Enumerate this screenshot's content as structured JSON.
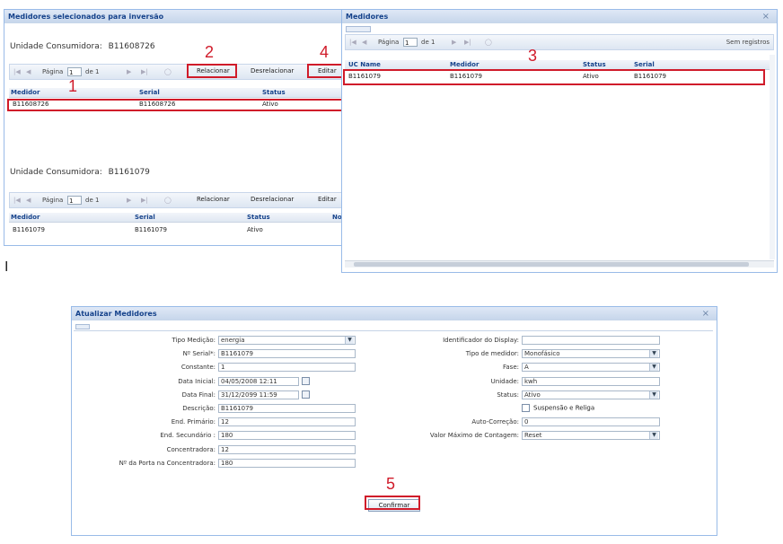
{
  "top_left_panel": {
    "title": "Medidores selecionados para inversão",
    "group1": {
      "unit_label": "Unidade Consumidora:",
      "unit_value": "B11608726",
      "toolbar": {
        "page_label": "Página",
        "page_value": "1",
        "of_label": "de 1",
        "relacionar": "Relacionar",
        "desrelacionar": "Desrelacionar",
        "editar": "Editar"
      },
      "columns": [
        "Medidor",
        "Serial",
        "Status"
      ],
      "rows": [
        [
          "B11608726",
          "B11608726",
          "Ativo"
        ]
      ]
    },
    "group2": {
      "unit_label": "Unidade Consumidora:",
      "unit_value": "B1161079",
      "toolbar": {
        "page_label": "Página",
        "page_value": "1",
        "of_label": "de 1",
        "relacionar": "Relacionar",
        "desrelacionar": "Desrelacionar",
        "editar": "Editar"
      },
      "columns": [
        "Medidor",
        "Serial",
        "Status",
        "No"
      ],
      "rows": [
        [
          "B1161079",
          "B1161079",
          "Ativo"
        ]
      ]
    }
  },
  "medidores_window": {
    "title": "Medidores",
    "close": "×",
    "toolbar": {
      "page_label": "Página",
      "page_value": "1",
      "of_label": "de 1",
      "no_records": "Sem registros"
    },
    "columns": [
      "UC Name",
      "Medidor",
      "Status",
      "Serial"
    ],
    "rows": [
      [
        "B1161079",
        "B1161079",
        "Ativo",
        "B1161079"
      ]
    ]
  },
  "cursor_glyph": "I",
  "markers": {
    "m1": "1",
    "m2": "2",
    "m3": "3",
    "m4": "4",
    "m5": "5"
  },
  "update_dialog": {
    "title": "Atualizar Medidores",
    "close": "×",
    "left_fields": [
      {
        "label": "Tipo Medição:",
        "value": "energia",
        "kind": "select"
      },
      {
        "label": "Nº Serial*:",
        "value": "B1161079",
        "kind": "text"
      },
      {
        "label": "Constante:",
        "value": "1",
        "kind": "text"
      },
      {
        "label": "Data Inicial:",
        "value": "04/05/2008 12:11",
        "kind": "date"
      },
      {
        "label": "Data Final:",
        "value": "31/12/2099 11:59",
        "kind": "date"
      },
      {
        "label": "Descrição:",
        "value": "B1161079",
        "kind": "text"
      },
      {
        "label": "End. Primário:",
        "value": "12",
        "kind": "text"
      },
      {
        "label": "End. Secundário :",
        "value": "180",
        "kind": "text"
      },
      {
        "label": "Concentradora:",
        "value": "12",
        "kind": "text"
      },
      {
        "label": "Nº da Porta na Concentradora:",
        "value": "180",
        "kind": "text"
      }
    ],
    "right_fields": [
      {
        "label": "Identificador do Display:",
        "value": "",
        "kind": "text"
      },
      {
        "label": "Tipo de medidor:",
        "value": "Monofásico",
        "kind": "select"
      },
      {
        "label": "Fase:",
        "value": "A",
        "kind": "select"
      },
      {
        "label": "Unidade:",
        "value": "kwh",
        "kind": "text"
      },
      {
        "label": "Status:",
        "value": "Ativo",
        "kind": "select"
      },
      {
        "label": "",
        "value": "Suspensão e Religa",
        "kind": "checkbox"
      },
      {
        "label": "Auto-Correção:",
        "value": "0",
        "kind": "text"
      },
      {
        "label": "Valor Máximo de Contagem:",
        "value": "Reset",
        "kind": "select"
      }
    ],
    "confirm": "Confirmar"
  },
  "colors": {
    "red": "#d01b2a",
    "header_blue": "#15428b",
    "border": "#99bbe8"
  }
}
